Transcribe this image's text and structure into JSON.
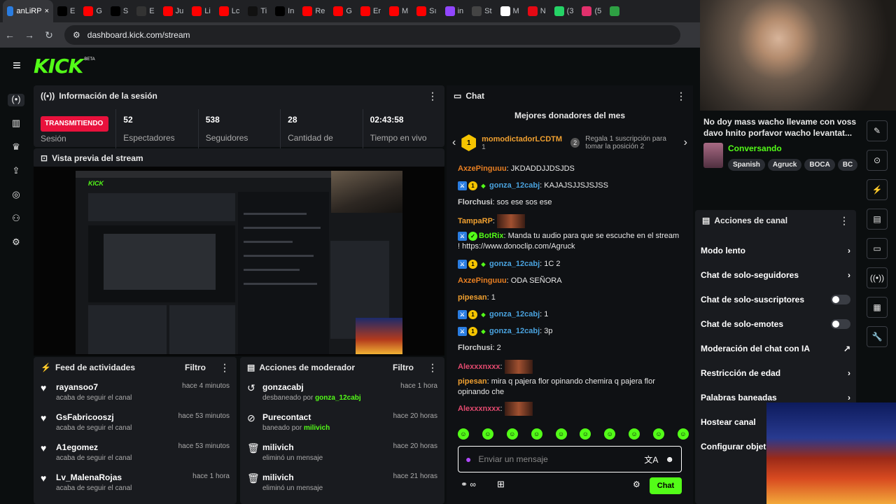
{
  "browser": {
    "tabs": [
      {
        "label": "anLiRP",
        "icon": "ri-icon",
        "color": "#2a7de1"
      },
      {
        "label": "E",
        "icon": "x-icon",
        "color": "#000000"
      },
      {
        "label": "G",
        "icon": "youtube-icon",
        "color": "#ff0000"
      },
      {
        "label": "S",
        "icon": "x-icon",
        "color": "#000000"
      },
      {
        "label": "E",
        "icon": "diamond-icon",
        "color": "#333333"
      },
      {
        "label": "Ju",
        "icon": "youtube-icon",
        "color": "#ff0000"
      },
      {
        "label": "Li",
        "icon": "youtube-icon",
        "color": "#ff0000"
      },
      {
        "label": "Lc",
        "icon": "youtube-icon",
        "color": "#ff0000"
      },
      {
        "label": "Ti",
        "icon": "tiktok-icon",
        "color": "#111111"
      },
      {
        "label": "In",
        "icon": "x-icon",
        "color": "#000000"
      },
      {
        "label": "Re",
        "icon": "youtube-icon",
        "color": "#ff0000"
      },
      {
        "label": "G",
        "icon": "youtube-icon",
        "color": "#ff0000"
      },
      {
        "label": "Er",
        "icon": "youtube-icon",
        "color": "#ff0000"
      },
      {
        "label": "M",
        "icon": "youtube-icon",
        "color": "#ff0000"
      },
      {
        "label": "Sı",
        "icon": "youtube-icon",
        "color": "#ff0000"
      },
      {
        "label": "in",
        "icon": "twitch-icon",
        "color": "#9146ff"
      },
      {
        "label": "St",
        "icon": "circle-icon",
        "color": "#444444"
      },
      {
        "label": "M",
        "icon": "news-icon",
        "color": "#ffffff"
      },
      {
        "label": "N",
        "icon": "netflix-icon",
        "color": "#e50914"
      },
      {
        "label": "(3",
        "icon": "whatsapp-icon",
        "color": "#25d366"
      },
      {
        "label": "(5",
        "icon": "instagram-icon",
        "color": "#e1306c"
      },
      {
        "label": "",
        "icon": "shield-icon",
        "color": "#2ea043"
      }
    ],
    "url": "dashboard.kick.com/stream"
  },
  "header": {
    "logo": "KICK",
    "beta": "BETA"
  },
  "session": {
    "title": "Información de la sesión",
    "live_badge": "TRANSMITIENDO",
    "live_sub": "Sesión",
    "stats": [
      {
        "value": "52",
        "label": "Espectadores"
      },
      {
        "value": "538",
        "label": "Seguidores"
      },
      {
        "value": "28",
        "label": "Cantidad de"
      },
      {
        "value": "02:43:58",
        "label": "Tiempo en vivo"
      }
    ]
  },
  "preview": {
    "title": "Vista previa del stream"
  },
  "feed": {
    "title": "Feed de actividades",
    "filter": "Filtro",
    "items": [
      {
        "name": "rayansoo7",
        "sub": "acaba de seguir el canal",
        "time": "hace 4 minutos"
      },
      {
        "name": "GsFabricooszj",
        "sub": "acaba de seguir el canal",
        "time": "hace 53 minutos"
      },
      {
        "name": "A1egomez",
        "sub": "acaba de seguir el canal",
        "time": "hace 53 minutos"
      },
      {
        "name": "Lv_MalenaRojas",
        "sub": "acaba de seguir el canal",
        "time": "hace 1 hora"
      }
    ]
  },
  "modactions": {
    "title": "Acciones de moderador",
    "filter": "Filtro",
    "items": [
      {
        "name": "gonzacabj",
        "sub": "desbaneado por",
        "by": "gonza_12cabj",
        "time": "hace 1 hora",
        "icon": "undo-icon"
      },
      {
        "name": "Purecontact",
        "sub": "baneado por",
        "by": "milivich",
        "time": "hace 20 horas",
        "icon": "ban-icon"
      },
      {
        "name": "milivich",
        "sub": "eliminó un mensaje",
        "by": "",
        "time": "hace 20 horas",
        "icon": "trash-icon"
      },
      {
        "name": "milivich",
        "sub": "eliminó un mensaje",
        "by": "",
        "time": "hace 21 horas",
        "icon": "trash-icon"
      }
    ]
  },
  "chat": {
    "title": "Chat",
    "donors_title": "Mejores donadores del mes",
    "top_donor": {
      "rank": "1",
      "name": "momodictadorLCDTM",
      "count": "1"
    },
    "second": {
      "rank": "2",
      "text": "Regala 1 suscripción para tomar la posición 2"
    },
    "messages": [
      {
        "user": "AxzePinguuu",
        "color": "#e67e22",
        "text": "JKDADDJJDSJDS",
        "badges": []
      },
      {
        "user": "gonza_12cabj",
        "color": "#4aa3df",
        "text": "KAJAJSJJSJSJSS",
        "badges": [
          "mod",
          "sub",
          "vip"
        ]
      },
      {
        "user": "Florchusi",
        "color": "#cfcfcf",
        "text": "sos ese sos ese",
        "badges": []
      },
      {
        "user": "TampaRP",
        "color": "#f0a030",
        "text": "",
        "badges": [],
        "emote": true
      },
      {
        "user": "BotRix",
        "color": "#53fc18",
        "text": "Manda tu audio para que se escuche en el stream ! https://www.donoclip.com/Agruck",
        "badges": [
          "mod",
          "verified"
        ]
      },
      {
        "user": "gonza_12cabj",
        "color": "#4aa3df",
        "text": "1C 2",
        "badges": [
          "mod",
          "sub",
          "vip"
        ]
      },
      {
        "user": "AxzePinguuu",
        "color": "#e67e22",
        "text": "ODA SEÑORA",
        "badges": []
      },
      {
        "user": "pipesan",
        "color": "#f0a030",
        "text": "1",
        "badges": []
      },
      {
        "user": "gonza_12cabj",
        "color": "#4aa3df",
        "text": "1",
        "badges": [
          "mod",
          "sub",
          "vip"
        ]
      },
      {
        "user": "gonza_12cabj",
        "color": "#4aa3df",
        "text": "3p",
        "badges": [
          "mod",
          "sub",
          "vip"
        ]
      },
      {
        "user": "Florchusi",
        "color": "#cfcfcf",
        "text": "2",
        "badges": []
      },
      {
        "user": "Alexxxnxxx",
        "color": "#e34a6f",
        "text": "",
        "badges": [],
        "emote": true
      },
      {
        "user": "pipesan",
        "color": "#f0a030",
        "text": "mira q pajera flor opinando chemira q pajera flor opinando che",
        "badges": []
      },
      {
        "user": "Alexxxnxxx",
        "color": "#e34a6f",
        "text": "",
        "badges": [],
        "emote": true
      }
    ],
    "input_placeholder": "Enviar un mensaje",
    "send_label": "Chat"
  },
  "streamcard": {
    "title": "No doy mass wacho llevame con voss davo hnito porfavor wacho levantat...",
    "category": "Conversando",
    "tags": [
      "Spanish",
      "Agruck",
      "BOCA",
      "BC"
    ]
  },
  "channel_actions": {
    "title": "Acciones de canal",
    "items": [
      {
        "label": "Modo lento",
        "control": "chevron"
      },
      {
        "label": "Chat de solo-seguidores",
        "control": "chevron"
      },
      {
        "label": "Chat de solo-suscriptores",
        "control": "toggle"
      },
      {
        "label": "Chat de solo-emotes",
        "control": "toggle"
      },
      {
        "label": "Moderación del chat con IA",
        "control": "external"
      },
      {
        "label": "Restricción de edad",
        "control": "chevron"
      },
      {
        "label": "Palabras baneadas",
        "control": "chevron"
      },
      {
        "label": "Hostear canal",
        "control": ""
      },
      {
        "label": "Configurar objetiv",
        "control": ""
      }
    ]
  },
  "colors": {
    "accent": "#53fc18",
    "live": "#e9113c",
    "panel": "#191b1f"
  }
}
